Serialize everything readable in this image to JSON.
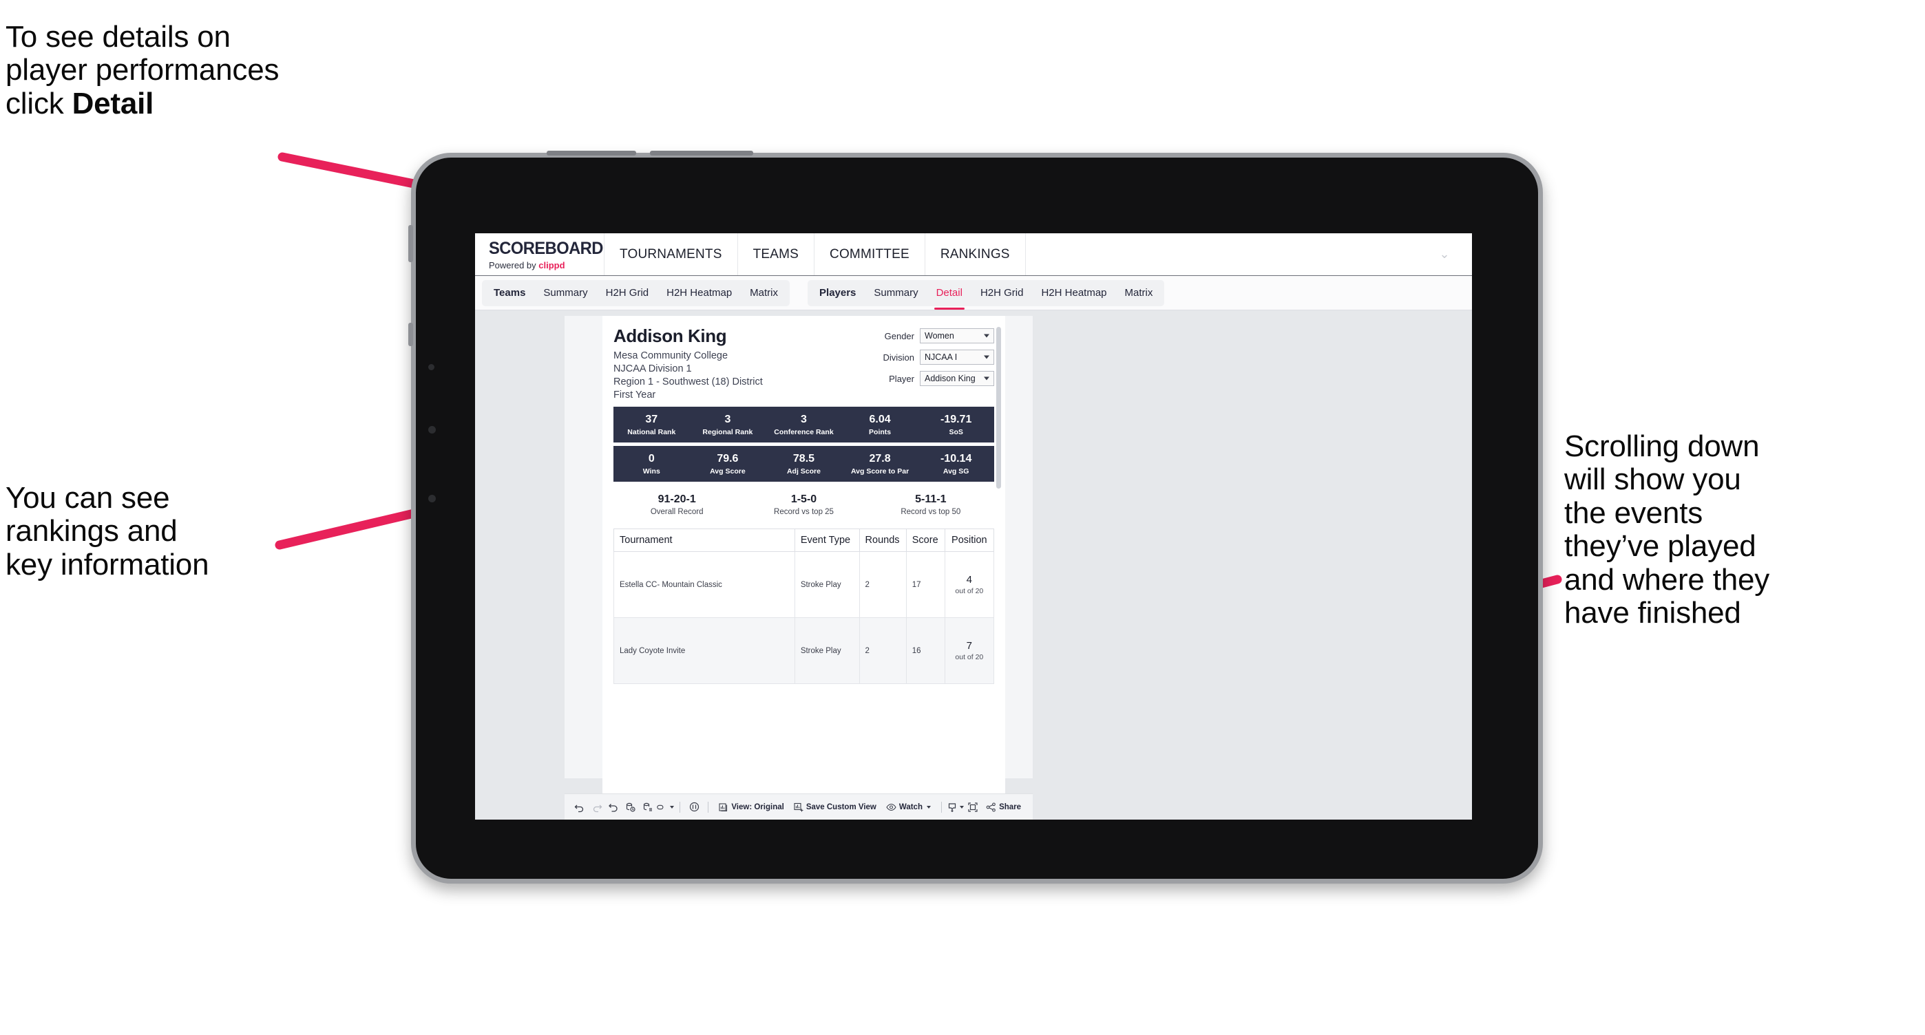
{
  "annotations": {
    "detail_note": {
      "text_a": "To see details on\nplayer performances\nclick ",
      "text_b": "Detail"
    },
    "rankings_note": {
      "text": "You can see\nrankings and\nkey information"
    },
    "scroll_note": {
      "text": "Scrolling down\nwill show you\nthe events\nthey’ve played\nand where they\nhave finished"
    },
    "arrow_color": "#e8215a"
  },
  "app": {
    "brand": {
      "title": "SCOREBOARD",
      "powered_prefix": "Powered by ",
      "powered_name": "clippd"
    },
    "topnav": [
      {
        "label": "TOURNAMENTS"
      },
      {
        "label": "TEAMS"
      },
      {
        "label": "COMMITTEE"
      },
      {
        "label": "RANKINGS"
      }
    ],
    "tabs_teams": [
      {
        "label": "Teams",
        "active": false
      },
      {
        "label": "Summary",
        "active": false
      },
      {
        "label": "H2H Grid",
        "active": false
      },
      {
        "label": "H2H Heatmap",
        "active": false
      },
      {
        "label": "Matrix",
        "active": false
      }
    ],
    "tabs_players": [
      {
        "label": "Players",
        "active": false
      },
      {
        "label": "Summary",
        "active": false
      },
      {
        "label": "Detail",
        "active": true
      },
      {
        "label": "H2H Grid",
        "active": false
      },
      {
        "label": "H2H Heatmap",
        "active": false
      },
      {
        "label": "Matrix",
        "active": false
      }
    ],
    "accent": "#e8215a",
    "stat_bar_color": "#2e3349"
  },
  "player": {
    "name": "Addison King",
    "school": "Mesa Community College",
    "division": "NJCAA Division 1",
    "region": "Region 1 - Southwest (18) District",
    "class_year": "First Year"
  },
  "filters": [
    {
      "label": "Gender",
      "value": "Women"
    },
    {
      "label": "Division",
      "value": "NJCAA I"
    },
    {
      "label": "Player",
      "value": "Addison King"
    }
  ],
  "stats_row1": [
    {
      "value": "37",
      "label": "National Rank"
    },
    {
      "value": "3",
      "label": "Regional Rank"
    },
    {
      "value": "3",
      "label": "Conference Rank"
    },
    {
      "value": "6.04",
      "label": "Points"
    },
    {
      "value": "-19.71",
      "label": "SoS"
    }
  ],
  "stats_row2": [
    {
      "value": "0",
      "label": "Wins"
    },
    {
      "value": "79.6",
      "label": "Avg Score"
    },
    {
      "value": "78.5",
      "label": "Adj Score"
    },
    {
      "value": "27.8",
      "label": "Avg Score to Par"
    },
    {
      "value": "-10.14",
      "label": "Avg SG"
    }
  ],
  "records": [
    {
      "value": "91-20-1",
      "label": "Overall Record"
    },
    {
      "value": "1-5-0",
      "label": "Record vs top 25"
    },
    {
      "value": "5-11-1",
      "label": "Record vs top 50"
    }
  ],
  "tournaments": {
    "columns": [
      "Tournament",
      "Event Type",
      "Rounds",
      "Score",
      "Position"
    ],
    "rows": [
      {
        "tournament": "Estella CC- Mountain Classic",
        "event_type": "Stroke Play",
        "rounds": "2",
        "score": "17",
        "position": "4",
        "position_of": "out of 20"
      },
      {
        "tournament": "Lady Coyote Invite",
        "event_type": "Stroke Play",
        "rounds": "2",
        "score": "16",
        "position": "7",
        "position_of": "out of 20"
      }
    ]
  },
  "toolbar": {
    "icons": [
      "undo-icon",
      "redo-icon",
      "revert-icon",
      "refresh-data-icon",
      "pause-auto-update-icon",
      "device-layout-icon"
    ],
    "view_label": "View: Original",
    "save_label": "Save Custom View",
    "watch_label": "Watch",
    "share_label": "Share"
  }
}
